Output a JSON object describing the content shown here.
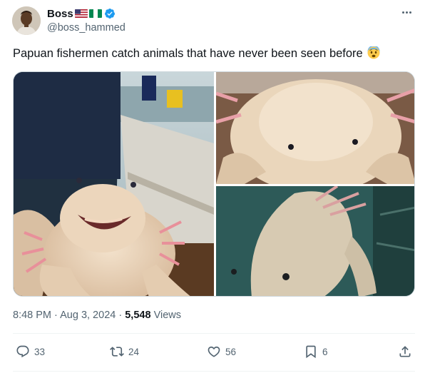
{
  "author": {
    "display_name": "Boss",
    "handle": "@boss_hammed",
    "badges": [
      "us-flag-icon",
      "nigeria-flag-icon",
      "verified-badge-icon"
    ]
  },
  "tweet": {
    "text": "Papuan fishermen catch animals that have never been seen before",
    "emoji": "fearful-face-icon"
  },
  "meta": {
    "time": "8:48 PM",
    "separator": "·",
    "date": "Aug 3, 2024",
    "views_count": "5,548",
    "views_label": "Views"
  },
  "actions": {
    "replies": "33",
    "retweets": "24",
    "likes": "56",
    "bookmarks": "6"
  },
  "colors": {
    "text": "#0f1419",
    "secondary": "#536471",
    "verified": "#1d9bf0",
    "border": "#cfd9de"
  }
}
